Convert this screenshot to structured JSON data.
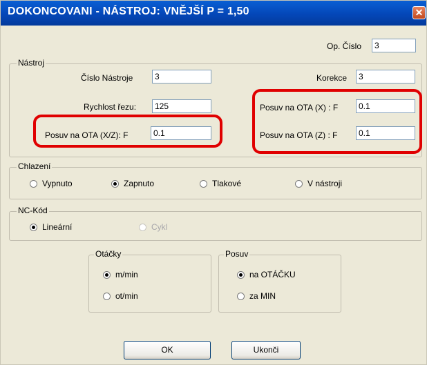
{
  "window": {
    "title": "DOKONCOVANI - NÁSTROJ: VNĚJŠÍ P = 1,50",
    "close_glyph": "✕"
  },
  "op": {
    "label": "Op. Číslo",
    "value": "3"
  },
  "nastroj": {
    "legend": "Nástroj",
    "cislo_label": "Číslo Nástroje",
    "cislo_value": "3",
    "korekce_label": "Korekce",
    "korekce_value": "3",
    "rychlost_label": "Rychlost řezu:",
    "rychlost_value": "125",
    "posuv_xz_label": "Posuv na OTA (X/Z): F",
    "posuv_xz_value": "0.1",
    "posuv_x_label": "Posuv na OTA (X)  : F",
    "posuv_x_value": "0.1",
    "posuv_z_label": "Posuv na OTA (Z)  : F",
    "posuv_z_value": "0.1"
  },
  "chlazeni": {
    "legend": "Chlazení",
    "options": [
      "Vypnuto",
      "Zapnuto",
      "Tlakové",
      "V nástroji"
    ],
    "selected": "Zapnuto"
  },
  "nckod": {
    "legend": "NC-Kód",
    "options": [
      "Lineární",
      "Cykl"
    ],
    "selected": "Lineární",
    "disabled": [
      "Cykl"
    ]
  },
  "otacky": {
    "legend": "Otáčky",
    "options": [
      "m/min",
      "ot/min"
    ],
    "selected": "m/min"
  },
  "posuv": {
    "legend": "Posuv",
    "options": [
      "na OTÁČKU",
      "za MIN"
    ],
    "selected": "na OTÁČKU"
  },
  "buttons": {
    "ok": "OK",
    "ukonci": "Ukonči"
  },
  "colors": {
    "titlebar": "#0447b8",
    "dialog_bg": "#ece9d8",
    "highlight": "#e00000"
  }
}
